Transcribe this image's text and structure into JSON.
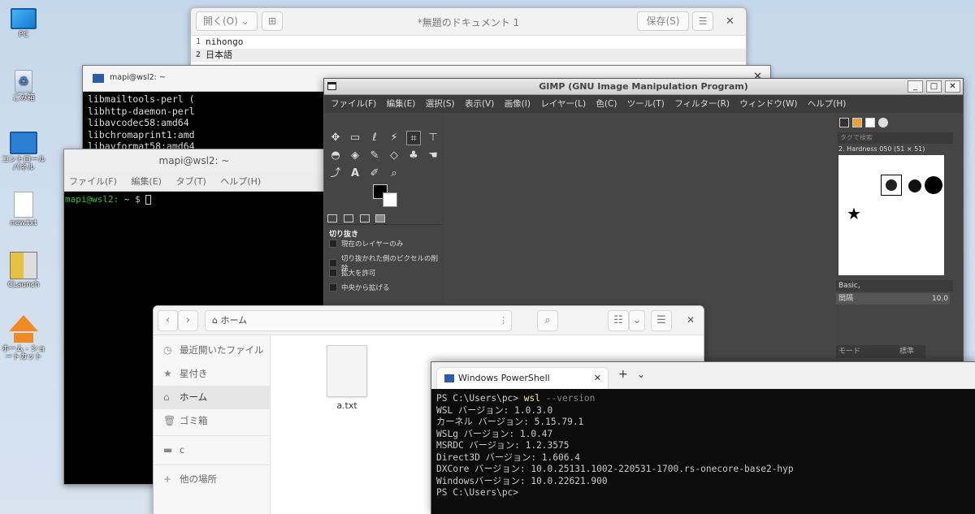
{
  "desktop": {
    "icons": [
      {
        "label": "PC",
        "name": "pc-icon"
      },
      {
        "label": "ごみ箱",
        "name": "recycle-bin-icon"
      },
      {
        "label": "コントロール パネル",
        "name": "control-panel-icon"
      },
      {
        "label": "new.txt",
        "name": "text-file-icon"
      },
      {
        "label": "CLaunch",
        "name": "clauncher-icon"
      },
      {
        "label": "ホーム - ショートカット",
        "name": "home-shortcut-icon"
      }
    ]
  },
  "gedit": {
    "open_label": "開く(O)",
    "title": "*無題のドキュメント 1",
    "save_label": "保存(S)",
    "lines": [
      {
        "num": "1",
        "text": "nihongo"
      },
      {
        "num": "2",
        "text": "日本語"
      }
    ]
  },
  "term1": {
    "title": "mapi@wsl2: ~",
    "lines": "libmailtools-perl (\nlibhttp-daemon-perl\nlibavcodec58:amd64\nlibchromaprint1:amd\nlibavformat58:amd64"
  },
  "term2": {
    "title": "mapi@wsl2: ~",
    "menu": [
      "ファイル(F)",
      "編集(E)",
      "タブ(T)",
      "ヘルプ(H)"
    ],
    "prompt": "mapi@wsl2:",
    "prompt_suffix": " ~ $"
  },
  "gimp": {
    "title": "GIMP (GNU Image Manipulation Program)",
    "menu": [
      "ファイル(F)",
      "編集(E)",
      "選択(S)",
      "表示(V)",
      "画像(I)",
      "レイヤー(L)",
      "色(C)",
      "ツール(T)",
      "フィルター(R)",
      "ウィンドウ(W)",
      "ヘルプ(H)"
    ],
    "tool_options_title": "切り抜き",
    "options": [
      "現在のレイヤーのみ",
      "切り抜かれた側のピクセルの削除",
      "拡大を許可",
      "中央から拡げる"
    ],
    "brush_tag_placeholder": "タグで検索",
    "brush_name": "2. Hardness 050 (51 × 51)",
    "brush_preset": "Basic,",
    "spacing_label": "間隔",
    "spacing_value": "10.0",
    "mode_label": "モード",
    "mode_value": "標準"
  },
  "files": {
    "location": "ホーム",
    "sidebar": [
      "最近開いたファイル",
      "星付き",
      "ホーム",
      "ゴミ箱",
      "c",
      "他の場所"
    ],
    "file_name": "a.txt"
  },
  "powershell": {
    "tab_title": "Windows PowerShell",
    "prompt": "PS C:\\Users\\pc> ",
    "cmd": "wsl",
    "arg": " --version",
    "output": [
      "WSL バージョン: 1.0.3.0",
      "カーネル バージョン: 5.15.79.1",
      "WSLg バージョン: 1.0.47",
      "MSRDC バージョン: 1.2.3575",
      "Direct3D バージョン: 1.606.4",
      "DXCore バージョン: 10.0.25131.1002-220531-1700.rs-onecore-base2-hyp",
      "Windowsバージョン: 10.0.22621.900",
      "PS C:\\Users\\pc>"
    ]
  }
}
